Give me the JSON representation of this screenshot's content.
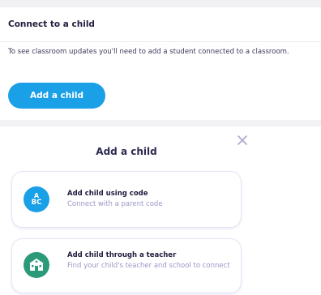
{
  "connect_card": {
    "title": "Connect to a child",
    "description": "To see classroom updates you'll need to add a student connected to a classroom.",
    "add_button_label": "Add a child"
  },
  "modal": {
    "title": "Add a child",
    "close_icon": "close-icon",
    "options": [
      {
        "icon": "abc-icon",
        "icon_text_line1": "A",
        "icon_text_line2": "BC",
        "title": "Add child using code",
        "subtitle": "Connect with a parent code",
        "icon_color": "#1aa0e6"
      },
      {
        "icon": "school-icon",
        "title": "Add child through a teacher",
        "subtitle": "Find your child's teacher and school to connect",
        "icon_color": "#2b9a78"
      }
    ]
  },
  "colors": {
    "accent": "#1aa0e6",
    "text_dark": "#1f1d3d",
    "text_muted": "#9a98c6",
    "option_border": "#e5e3f3"
  }
}
